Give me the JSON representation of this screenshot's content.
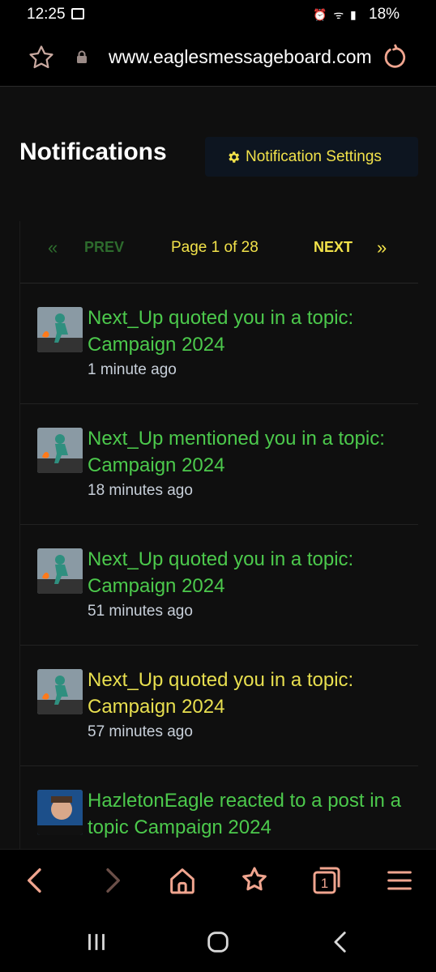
{
  "status": {
    "time": "12:25",
    "battery": "18%"
  },
  "browser": {
    "url": "www.eaglesmessageboard.com"
  },
  "page": {
    "title": "Notifications",
    "settings_label": "Notification Settings",
    "pager": {
      "prev": "PREV",
      "info": "Page 1 of 28",
      "next": "NEXT",
      "prev_arrow": "«",
      "next_arrow": "»"
    }
  },
  "notifications": [
    {
      "text": "Next_Up quoted you in a topic: Campaign 2024",
      "time": "1 minute ago",
      "unread": false
    },
    {
      "text": "Next_Up mentioned you in a topic: Campaign 2024",
      "time": "18 minutes ago",
      "unread": false
    },
    {
      "text": "Next_Up quoted you in a topic: Campaign 2024",
      "time": "51 minutes ago",
      "unread": false
    },
    {
      "text": "Next_Up quoted you in a topic: Campaign 2024",
      "time": "57 minutes ago",
      "unread": true
    },
    {
      "text": "HazletonEagle reacted to a post in a topic Campaign 2024",
      "time": "",
      "unread": false
    }
  ],
  "colors": {
    "read": "#4cc94c",
    "unread": "#e8df4f",
    "accent": "#f2e24a",
    "disabled": "#2d6b2d"
  }
}
